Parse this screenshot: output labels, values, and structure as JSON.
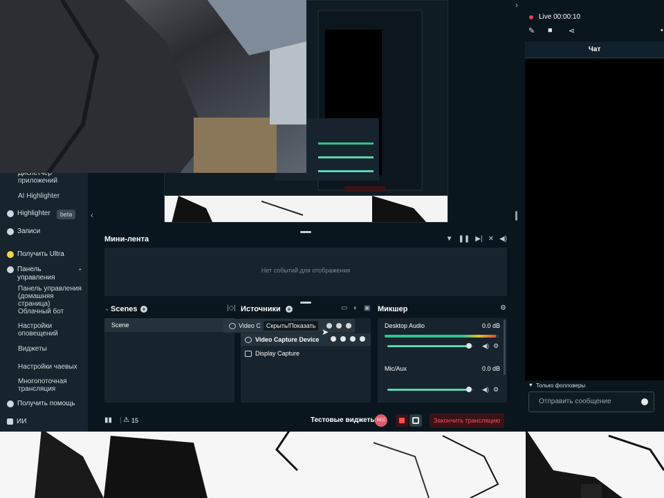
{
  "sidebar": {
    "items": [
      {
        "label": "Диспетчер приложений"
      },
      {
        "label": "AI Highlighter"
      },
      {
        "label": "Highlighter",
        "badge": "beta"
      },
      {
        "label": "Записи"
      },
      {
        "label": "Получить Ultra"
      },
      {
        "label": "Панель управления"
      },
      {
        "label": "Панель управления (домашняя страница)"
      },
      {
        "label": "Облачный бот"
      },
      {
        "label": "Настройки оповещений"
      },
      {
        "label": "Виджеты"
      },
      {
        "label": "Настройки чаевых"
      },
      {
        "label": "Многопоточная трансляция"
      },
      {
        "label": "Получить помощь"
      },
      {
        "label": "ИИ"
      }
    ]
  },
  "mini_feed": {
    "title": "Мини-лента",
    "empty_text": "Нет событий для отображения"
  },
  "scenes": {
    "title": "Scenes",
    "items": [
      "Scene"
    ]
  },
  "sources": {
    "title": "Источники",
    "drag_ghost": {
      "label": "Video C",
      "tooltip": "Скрыть/Показать"
    },
    "items": [
      "Video Capture Device",
      "Display Capture"
    ]
  },
  "mixer": {
    "title": "Микшер",
    "channels": [
      {
        "name": "Desktop Audio",
        "db": "0.0 dB",
        "meter": 0.97,
        "volume": 0.95
      },
      {
        "name": "Mic/Aux",
        "db": "0.0 dB",
        "meter": 0,
        "volume": 0.95
      }
    ]
  },
  "footer": {
    "warnings": "15",
    "test_widgets": "Тестовые виджеты",
    "rec_label": "REC",
    "end_stream": "Закончить трансляцию"
  },
  "chat": {
    "live": "Live 00:00:10",
    "tab": "Чат",
    "followers_only": "Только фолловеры",
    "placeholder": "Отправить сообщение"
  },
  "colors": {
    "app_bg": "#09161d",
    "panel_bg": "#17242d",
    "accent_green": "#31c48d",
    "live_red": "#e0444d",
    "end_red": "#ff4a55"
  }
}
